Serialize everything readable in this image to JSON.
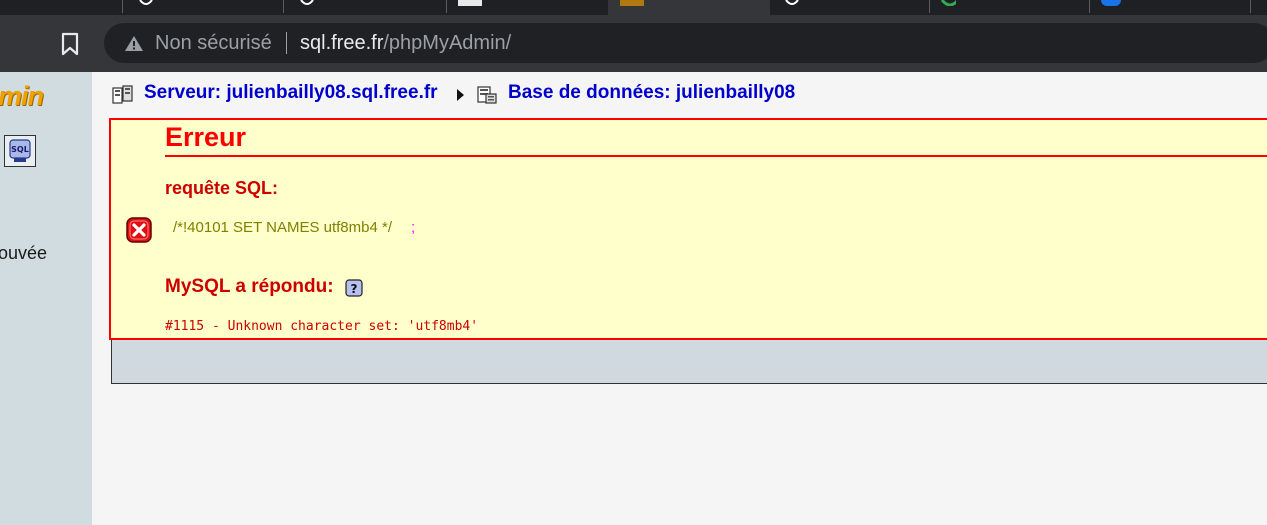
{
  "browser": {
    "security_label": "Non sécurisé",
    "url_host": "sql.free.fr",
    "url_path": "/phpMyAdmin/"
  },
  "left_frame": {
    "logo_fragment": "min",
    "found_fragment": "ouvée"
  },
  "breadcrumb": {
    "server": "Serveur: julienbailly08.sql.free.fr",
    "database": "Base de données: julienbailly08"
  },
  "error": {
    "title": "Erreur",
    "query_label": "requête SQL:",
    "query": "/*!40101 SET NAMES utf8mb4 */",
    "query_terminator": ";",
    "mysql_label": "MySQL a répondu:",
    "mysql_message": "#1115 - Unknown character set: 'utf8mb4'"
  },
  "colors": {
    "error_red": "#ff0000",
    "error_bg": "#ffffcc",
    "link_blue": "#0000cc",
    "browser_chrome": "#35363a"
  }
}
